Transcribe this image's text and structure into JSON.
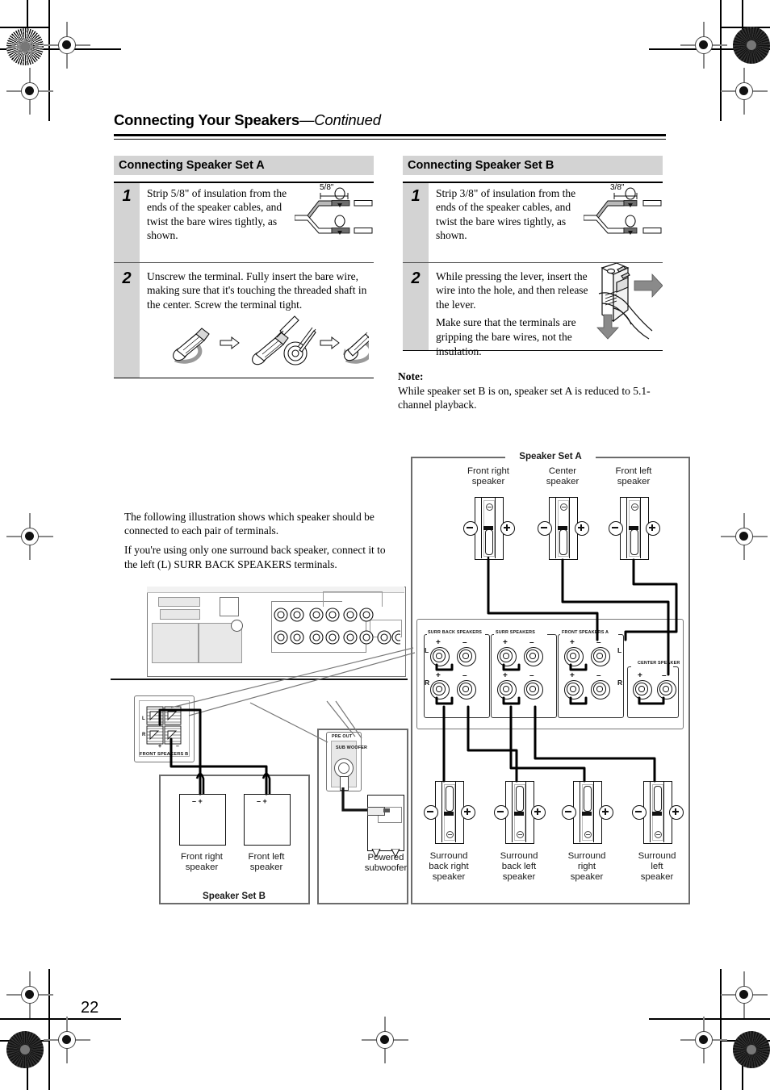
{
  "page": {
    "number": "22",
    "header_title_bold": "Connecting Your Speakers",
    "header_title_italic": "—Continued"
  },
  "sections": {
    "setA": {
      "heading": "Connecting Speaker Set A",
      "steps": [
        {
          "number": "1",
          "text": "Strip 5/8\" of insulation from the ends of the speaker cables, and twist the bare wires tightly, as shown.",
          "figure_dimension": "5/8\""
        },
        {
          "number": "2",
          "text": "Unscrew the terminal. Fully insert the bare wire, making sure that it's touching the threaded shaft in the center. Screw the terminal tight."
        }
      ]
    },
    "setB": {
      "heading": "Connecting Speaker Set B",
      "steps": [
        {
          "number": "1",
          "text": "Strip 3/8\" of insulation from the ends of the speaker cables, and twist the bare wires tightly, as shown.",
          "figure_dimension": "3/8\""
        },
        {
          "number": "2",
          "text_1": "While pressing the lever, insert the wire into the hole, and then release the lever.",
          "text_2": "Make sure that the terminals are gripping the bare wires, not the insulation."
        }
      ]
    }
  },
  "note": {
    "label": "Note:",
    "text": "While speaker set B is on, speaker set A is reduced to 5.1-channel playback."
  },
  "intro": {
    "p1": "The following illustration shows which speaker should be connected to each pair of terminals.",
    "p2": "If you're using only one surround back speaker, connect it to the left (L) SURR BACK SPEAKERS terminals."
  },
  "diagram": {
    "setA_title": "Speaker Set A",
    "setB_title": "Speaker Set B",
    "top_speakers": [
      {
        "line1": "Front right",
        "line2": "speaker"
      },
      {
        "line1": "Center",
        "line2": "speaker"
      },
      {
        "line1": "Front left",
        "line2": "speaker"
      }
    ],
    "bottom_speakers": [
      {
        "line1": "Surround",
        "line2": "back right",
        "line3": "speaker"
      },
      {
        "line1": "Surround",
        "line2": "back left",
        "line3": "speaker"
      },
      {
        "line1": "Surround",
        "line2": "right",
        "line3": "speaker"
      },
      {
        "line1": "Surround",
        "line2": "left",
        "line3": "speaker"
      }
    ],
    "setB_speakers": [
      {
        "line1": "Front right",
        "line2": "speaker"
      },
      {
        "line1": "Front left",
        "line2": "speaker"
      }
    ],
    "subwoofer": {
      "line1": "Powered",
      "line2": "subwoofer"
    },
    "terminal_groups": [
      {
        "name": "SURR BACK SPEAKERS"
      },
      {
        "name": "SURR SPEAKERS"
      },
      {
        "name": "FRONT SPEAKERS A"
      },
      {
        "name": "CENTER SPEAKER"
      }
    ],
    "terminal_polarity": {
      "plus": "+",
      "minus": "–",
      "left": "L",
      "right": "R"
    },
    "front_speakers_b_label": "FRONT SPEAKERS B",
    "pre_out_label": "PRE OUT",
    "sub_woofer_label": "SUB WOOFER",
    "small_speaker_polarity": "– +"
  }
}
